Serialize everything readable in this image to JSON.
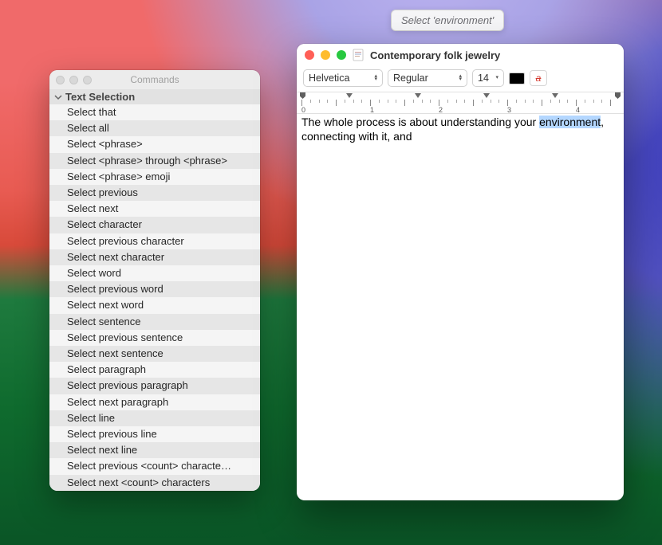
{
  "tooltip": {
    "text": "Select 'environment'"
  },
  "commands_window": {
    "title": "Commands",
    "section_header": "Text Selection",
    "items": [
      "Select that",
      "Select all",
      "Select <phrase>",
      "Select <phrase> through <phrase>",
      "Select <phrase> emoji",
      "Select previous",
      "Select next",
      "Select character",
      "Select previous character",
      "Select next character",
      "Select word",
      "Select previous word",
      "Select next word",
      "Select sentence",
      "Select previous sentence",
      "Select next sentence",
      "Select paragraph",
      "Select previous paragraph",
      "Select next paragraph",
      "Select line",
      "Select previous line",
      "Select next line",
      "Select previous <count> characte…",
      "Select next <count> characters"
    ]
  },
  "doc_window": {
    "title": "Contemporary folk jewelry",
    "toolbar": {
      "font": "Helvetica",
      "style": "Regular",
      "size": "14",
      "text_color": "#000000"
    },
    "ruler": {
      "labels": [
        "0",
        "1",
        "2",
        "3",
        "4"
      ]
    },
    "content": {
      "before_sel": "The whole process is about understanding your ",
      "selected": "environment",
      "after_sel": ", connecting with it, and"
    }
  }
}
